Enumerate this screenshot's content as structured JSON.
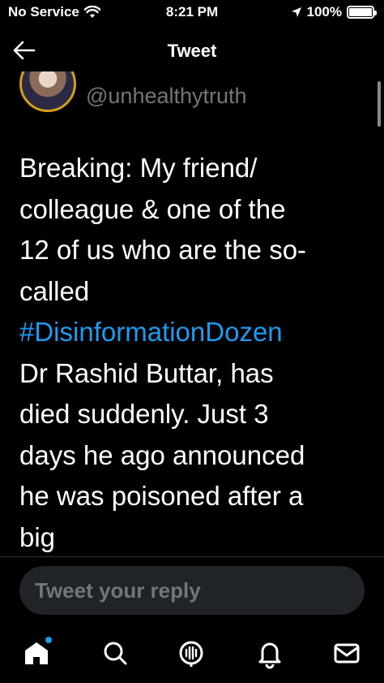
{
  "status": {
    "carrier": "No Service",
    "time": "8:21 PM",
    "battery": "100%"
  },
  "header": {
    "title": "Tweet"
  },
  "tweet": {
    "handle": "@unhealthytruth",
    "text_before": "Breaking: My friend/\ncolleague &  one of the\n12 of us who are the so-\ncalled\n",
    "hashtag": "#DisinformationDozen",
    "text_after": "\nDr Rashid Buttar, has\ndied suddenly. Just 3\ndays he ago announced\nhe was poisoned after a\nbig"
  },
  "reply": {
    "placeholder": "Tweet your reply"
  },
  "tabs": [
    "home-icon",
    "search-icon",
    "spaces-icon",
    "notifications-icon",
    "messages-icon"
  ],
  "colors": {
    "accent": "#1d9bf0",
    "avatar_ring": "#d4a017"
  }
}
